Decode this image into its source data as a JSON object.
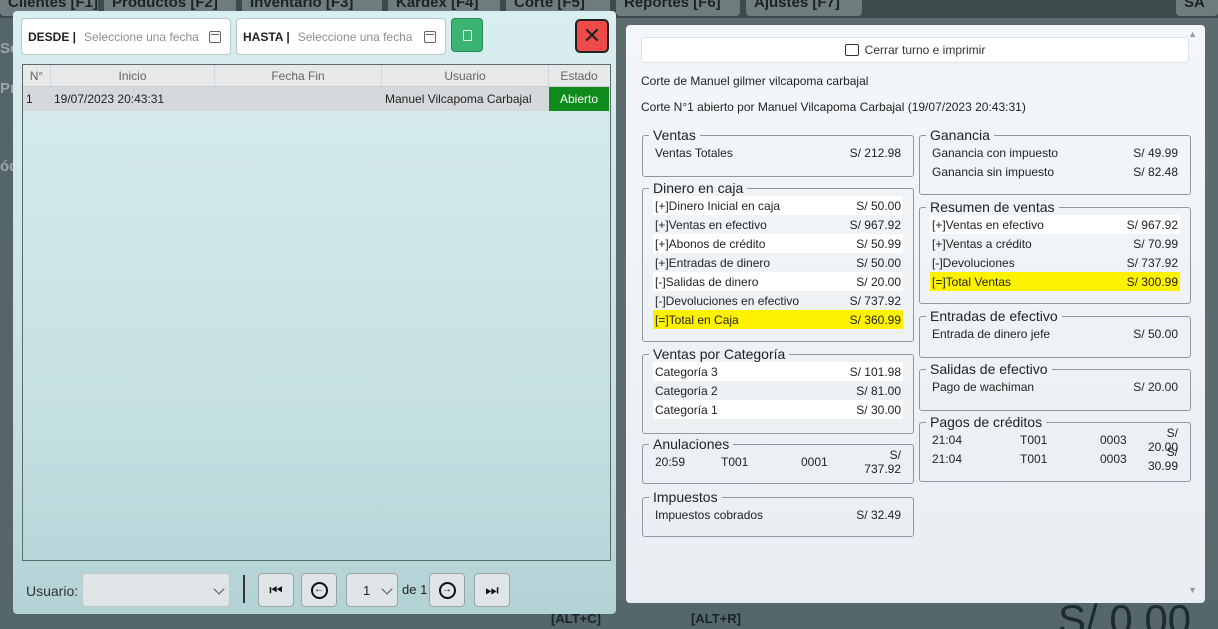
{
  "background": {
    "tabs": [
      {
        "label": "Clientes [F1]"
      },
      {
        "label": "Productos [F2]"
      },
      {
        "label": "Inventario [F3]"
      },
      {
        "label": "Kardex [F4]"
      },
      {
        "label": "Corte [F5]"
      },
      {
        "label": "Reportes [F6]"
      },
      {
        "label": "Ajustes [F7]"
      },
      {
        "label": "SA"
      }
    ],
    "side_labels": [
      "Se",
      "Pr",
      "ódi"
    ],
    "shortcuts": [
      "[ALT+C]",
      "[ALT+R]"
    ],
    "big_amount": "S/ 0.00"
  },
  "left": {
    "desde_label": "DESDE |",
    "desde_placeholder": "Seleccione una fecha",
    "hasta_label": "HASTA |",
    "hasta_placeholder": "Seleccione una fecha",
    "close_symbol": "✕",
    "columns": [
      "N°",
      "Inicio",
      "Fecha Fin",
      "Usuario",
      "Estado"
    ],
    "rows": [
      {
        "num": "1",
        "inicio": "19/07/2023 20:43:31",
        "fin": "",
        "usuario": "Manuel Vilcapoma Carbajal",
        "estado": "Abierto"
      }
    ],
    "status_color": "#0f8a1c",
    "user_label": "Usuario:",
    "page_current": "1",
    "page_of": "de 1"
  },
  "right": {
    "print_label": "Cerrar turno e imprimir",
    "corte_title": "Corte de Manuel gilmer vilcapoma carbajal",
    "corte_subtitle": "Corte N°1 abierto por Manuel Vilcapoma Carbajal (19/07/2023 20:43:31)",
    "highlight_color": "#fff200",
    "ventas": {
      "title": "Ventas",
      "rows": [
        {
          "label": "Ventas Totales",
          "value": "S/ 212.98"
        }
      ]
    },
    "dinero": {
      "title": "Dinero en caja",
      "rows": [
        {
          "label": "[+]Dinero Inicial en caja",
          "value": "S/ 50.00"
        },
        {
          "label": "[+]Ventas en efectivo",
          "value": "S/ 967.92"
        },
        {
          "label": "[+]Abonos de crédito",
          "value": "S/ 50.99"
        },
        {
          "label": "[+]Entradas de dinero",
          "value": "S/ 50.00"
        },
        {
          "label": "[-]Salidas de dinero",
          "value": "S/ 20.00"
        },
        {
          "label": "[-]Devoluciones en efectivo",
          "value": "S/ 737.92"
        },
        {
          "label": "[=]Total en Caja",
          "value": "S/ 360.99"
        }
      ]
    },
    "categoria": {
      "title": "Ventas por Categoría",
      "rows": [
        {
          "label": "Categoría 3",
          "value": "S/ 101.98"
        },
        {
          "label": "Categoría 2",
          "value": "S/ 81.00"
        },
        {
          "label": "Categoría 1",
          "value": "S/ 30.00"
        }
      ]
    },
    "anulaciones": {
      "title": "Anulaciones",
      "rows": [
        {
          "time": "20:59",
          "serie": "T001",
          "num": "0001",
          "value": "S/ 737.92"
        }
      ]
    },
    "impuestos": {
      "title": "Impuestos",
      "rows": [
        {
          "label": "Impuestos cobrados",
          "value": "S/ 32.49"
        }
      ]
    },
    "ganancia": {
      "title": "Ganancia",
      "rows": [
        {
          "label": "Ganancia con impuesto",
          "value": "S/ 49.99"
        },
        {
          "label": "Ganancia sin impuesto",
          "value": "S/ 82.48"
        }
      ]
    },
    "resumen": {
      "title": "Resumen de ventas",
      "rows": [
        {
          "label": "[+]Ventas en efectivo",
          "value": "S/ 967.92"
        },
        {
          "label": "[+]Ventas a crédito",
          "value": "S/ 70.99"
        },
        {
          "label": "[-]Devoluciones",
          "value": "S/ 737.92"
        },
        {
          "label": "[=]Total Ventas",
          "value": "S/ 300.99"
        }
      ]
    },
    "entradas": {
      "title": "Entradas de efectivo",
      "rows": [
        {
          "label": "Entrada de dinero jefe",
          "value": "S/ 50.00"
        }
      ]
    },
    "salidas": {
      "title": "Salidas de efectivo",
      "rows": [
        {
          "label": "Pago de wachiman",
          "value": "S/ 20.00"
        }
      ]
    },
    "pagos": {
      "title": "Pagos de créditos",
      "rows": [
        {
          "time": "21:04",
          "serie": "T001",
          "num": "0003",
          "value": "S/ 20.00"
        },
        {
          "time": "21:04",
          "serie": "T001",
          "num": "0003",
          "value": "S/ 30.99"
        }
      ]
    }
  }
}
